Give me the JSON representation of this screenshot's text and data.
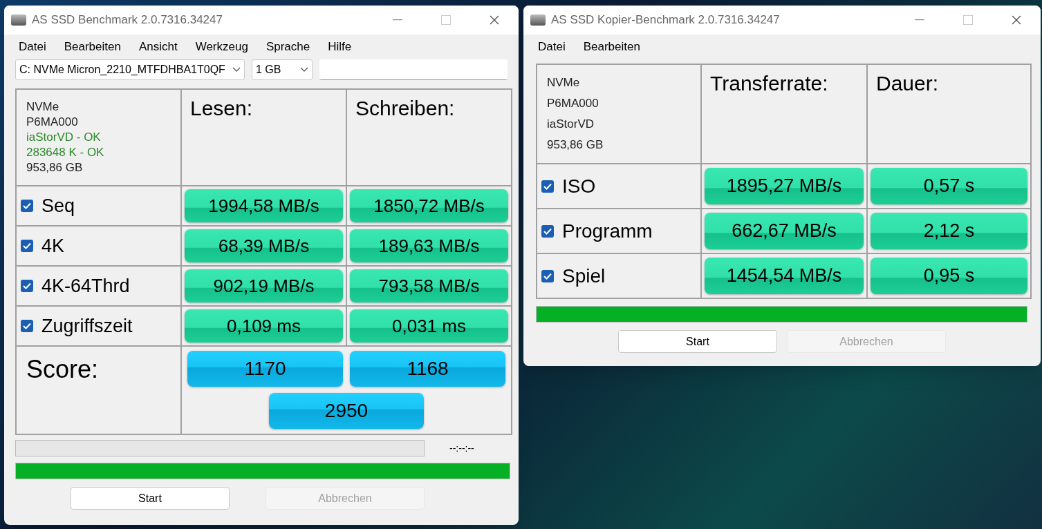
{
  "windows": [
    {
      "kind": "benchmark",
      "title": "AS SSD Benchmark 2.0.7316.34247",
      "menu": [
        "Datei",
        "Bearbeiten",
        "Ansicht",
        "Werkzeug",
        "Sprache",
        "Hilfe"
      ],
      "drive_select": "C: NVMe Micron_2210_MTFDHBA1T0QF",
      "size_select": "1 GB",
      "info": [
        {
          "text": "NVMe",
          "ok": false
        },
        {
          "text": "P6MA000",
          "ok": false
        },
        {
          "text": "iaStorVD - OK",
          "ok": true
        },
        {
          "text": "283648 K - OK",
          "ok": true
        },
        {
          "text": "953,86 GB",
          "ok": false
        }
      ],
      "columns": [
        "Lesen:",
        "Schreiben:"
      ],
      "rows": [
        {
          "label": "Seq",
          "checked": true,
          "values": [
            "1994,58 MB/s",
            "1850,72 MB/s"
          ]
        },
        {
          "label": "4K",
          "checked": true,
          "values": [
            "68,39 MB/s",
            "189,63 MB/s"
          ]
        },
        {
          "label": "4K-64Thrd",
          "checked": true,
          "values": [
            "902,19 MB/s",
            "793,58 MB/s"
          ]
        },
        {
          "label": "Zugriffszeit",
          "checked": true,
          "values": [
            "0,109 ms",
            "0,031 ms"
          ]
        }
      ],
      "score": {
        "label": "Score:",
        "read": "1170",
        "write": "1168",
        "total": "2950"
      },
      "test_progress": {
        "level": 0
      },
      "elapsed_time": "--:--:--",
      "overall_progress": {
        "level": 1
      },
      "buttons": [
        {
          "label": "Start",
          "disabled": false
        },
        {
          "label": "Abbrechen",
          "disabled": true
        }
      ]
    },
    {
      "kind": "copy",
      "title": "AS SSD Kopier-Benchmark 2.0.7316.34247",
      "menu": [
        "Datei",
        "Bearbeiten"
      ],
      "info": [
        {
          "text": "NVMe",
          "ok": false
        },
        {
          "text": "P6MA000",
          "ok": false
        },
        {
          "text": "iaStorVD",
          "ok": false
        },
        {
          "text": "953,86 GB",
          "ok": false
        }
      ],
      "columns": [
        "Transferrate:",
        "Dauer:"
      ],
      "rows": [
        {
          "label": "ISO",
          "checked": true,
          "values": [
            "1895,27 MB/s",
            "0,57 s"
          ]
        },
        {
          "label": "Programm",
          "checked": true,
          "values": [
            "662,67 MB/s",
            "2,12 s"
          ]
        },
        {
          "label": "Spiel",
          "checked": true,
          "values": [
            "1454,54 MB/s",
            "0,95 s"
          ]
        }
      ],
      "overall_progress": {
        "level": 1
      },
      "buttons": [
        {
          "label": "Start",
          "disabled": false
        },
        {
          "label": "Abbrechen",
          "disabled": true
        }
      ]
    }
  ]
}
